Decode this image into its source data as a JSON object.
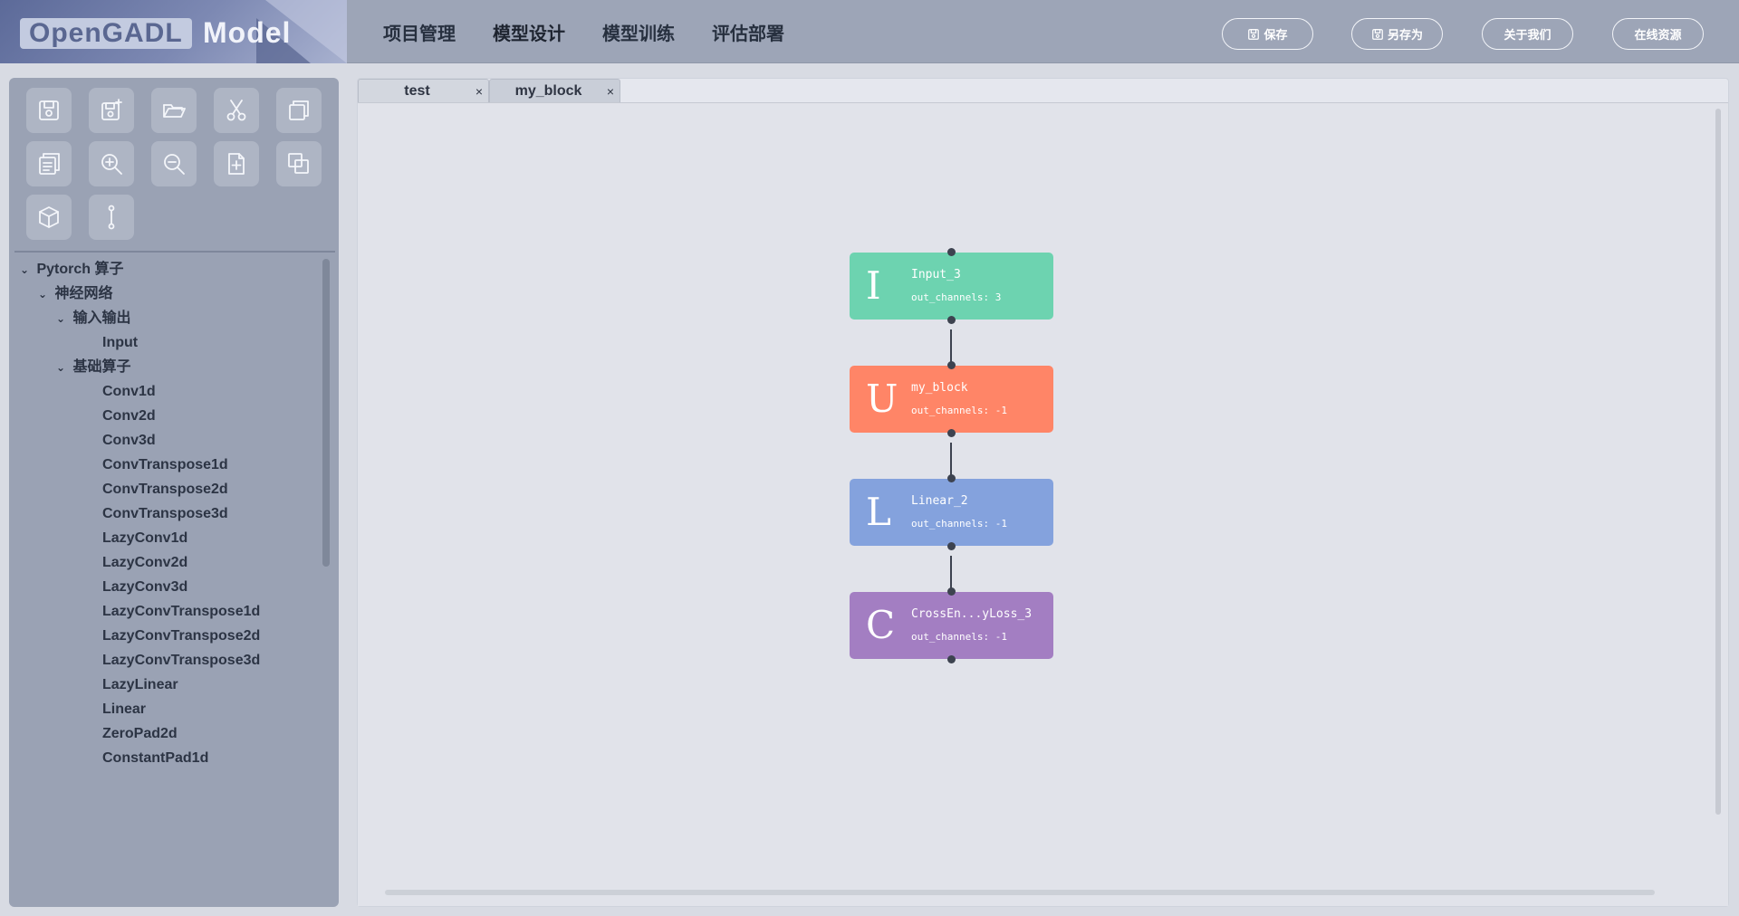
{
  "logo": {
    "part1": "OpenGADL",
    "part2": "Model"
  },
  "menu": [
    "项目管理",
    "模型设计",
    "模型训练",
    "评估部署"
  ],
  "top_buttons": {
    "save": "保存",
    "save_as": "另存为",
    "about": "关于我们",
    "resources": "在线资源"
  },
  "tree": {
    "root": "Pytorch 算子",
    "group": "神经网络",
    "io_group": "输入输出",
    "io_items": [
      "Input"
    ],
    "basic_group": "基础算子",
    "basic_items": [
      "Conv1d",
      "Conv2d",
      "Conv3d",
      "ConvTranspose1d",
      "ConvTranspose2d",
      "ConvTranspose3d",
      "LazyConv1d",
      "LazyConv2d",
      "LazyConv3d",
      "LazyConvTranspose1d",
      "LazyConvTranspose2d",
      "LazyConvTranspose3d",
      "LazyLinear",
      "Linear",
      "ZeroPad2d",
      "ConstantPad1d"
    ]
  },
  "tabs": [
    {
      "label": "test",
      "close": "×"
    },
    {
      "label": "my_block",
      "close": "×"
    }
  ],
  "nodes": [
    {
      "letter": "I",
      "name": "Input_3",
      "param": "out_channels: 3",
      "color": "#6dd3b0"
    },
    {
      "letter": "U",
      "name": "my_block",
      "param": "out_channels: -1",
      "color": "#ff8567"
    },
    {
      "letter": "L",
      "name": "Linear_2",
      "param": "out_channels: -1",
      "color": "#84a2dd"
    },
    {
      "letter": "C",
      "name": "CrossEn...yLoss_3",
      "param": "out_channels: -1",
      "color": "#a37ec2"
    }
  ]
}
